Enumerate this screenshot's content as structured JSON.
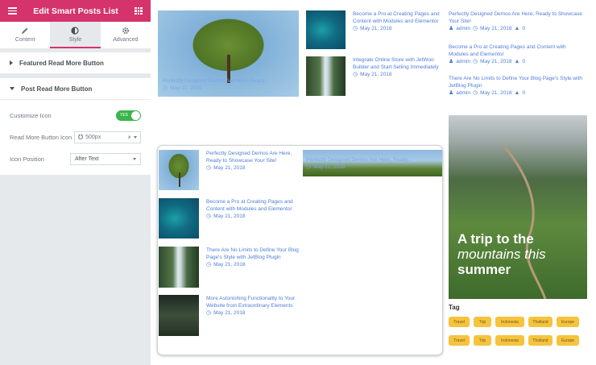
{
  "panel": {
    "title": "Edit Smart Posts List",
    "tabs": [
      {
        "label": "Content",
        "icon": "pencil-icon"
      },
      {
        "label": "Style",
        "icon": "half-circle-icon"
      },
      {
        "label": "Advanced",
        "icon": "gear-icon"
      }
    ],
    "sections": {
      "featured": "Featured Read More Button",
      "post": "Post Read More Button"
    },
    "controls": {
      "customize_label": "Customize Icon",
      "customize_toggle": "YES",
      "icon_label": "Read More Button Icon",
      "icon_value": "500px",
      "position_label": "Icon Position",
      "position_value": "After Text"
    }
  },
  "top": {
    "featured": {
      "title": "Perfectly Designed Demos Are Here, Ready...",
      "date": "May 21, 2018"
    },
    "list": [
      {
        "title": "Become a Pro at Creating Pages and Content with Modules and Elementor",
        "date": "May 21, 2018"
      },
      {
        "title": "Integrate Online Store with JetWoo Builder and Start Selling Immediately",
        "date": "May 21, 2018"
      }
    ]
  },
  "right_list": [
    {
      "title": "Perfectly Designed Demos Are Here, Ready to Showcase Your Site!",
      "author": "admin",
      "date": "May 21, 2018",
      "comments": "0"
    },
    {
      "title": "Become a Pro at Creating Pages and Content with Modules and Elementor",
      "author": "admin",
      "date": "May 21, 2018",
      "comments": "0"
    },
    {
      "title": "There Are No Limits to Define Your Blog Page's Style with JetBlog Plugin",
      "author": "admin",
      "date": "May 21, 2018",
      "comments": "0"
    }
  ],
  "middle": {
    "posts": [
      {
        "title": "Perfectly Designed Demos Are Here, Ready to Showcase Your Site!",
        "date": "May 21, 2018"
      },
      {
        "title": "Become a Pro at Creating Pages and Content with Modules and Elementor",
        "date": "May 21, 2018"
      },
      {
        "title": "There Are No Limits to Define Your Blog Page's Style with JetBlog Plugin",
        "date": "May 21, 2018"
      },
      {
        "title": "More Astonishing Functionality to Your Website from Extraordinary Elements",
        "date": "May 21, 2018"
      }
    ],
    "featured": {
      "title": "Perfectly Designed Demos Are Here, Ready...",
      "date": "May 21, 2018"
    }
  },
  "banner": {
    "line1": "A trip to the",
    "line2": "mountains this",
    "line3": "summer"
  },
  "tags": {
    "heading": "Tag",
    "row1": [
      "Travel",
      "Trip",
      "Indonesia",
      "Thailand",
      "Europe"
    ],
    "row2": [
      "Travel",
      "Trip",
      "Indonesia",
      "Thailand",
      "Europe"
    ]
  }
}
